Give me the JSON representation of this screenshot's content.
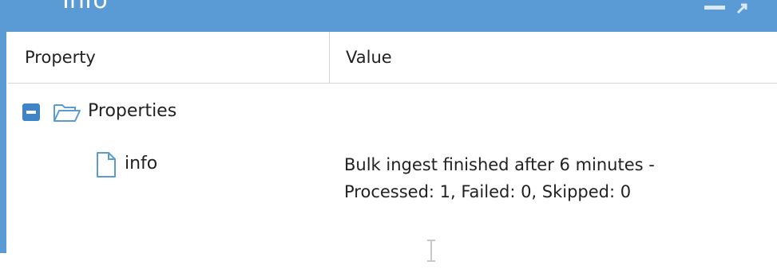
{
  "window": {
    "title": "Info",
    "accent_color": "#5b9bd5",
    "controls": [
      "minimize-icon",
      "restore-icon"
    ]
  },
  "table": {
    "columns": [
      "Property",
      "Value"
    ],
    "group": {
      "label": "Properties",
      "expanded": true,
      "icon": "folder-open-icon",
      "toggle_icon": "collapse-minus-icon"
    },
    "rows": [
      {
        "icon": "file-icon",
        "property": "info",
        "value_lines": [
          "Bulk ingest finished after 6 minutes -",
          "Processed: 1, Failed: 0, Skipped: 0"
        ]
      }
    ]
  }
}
